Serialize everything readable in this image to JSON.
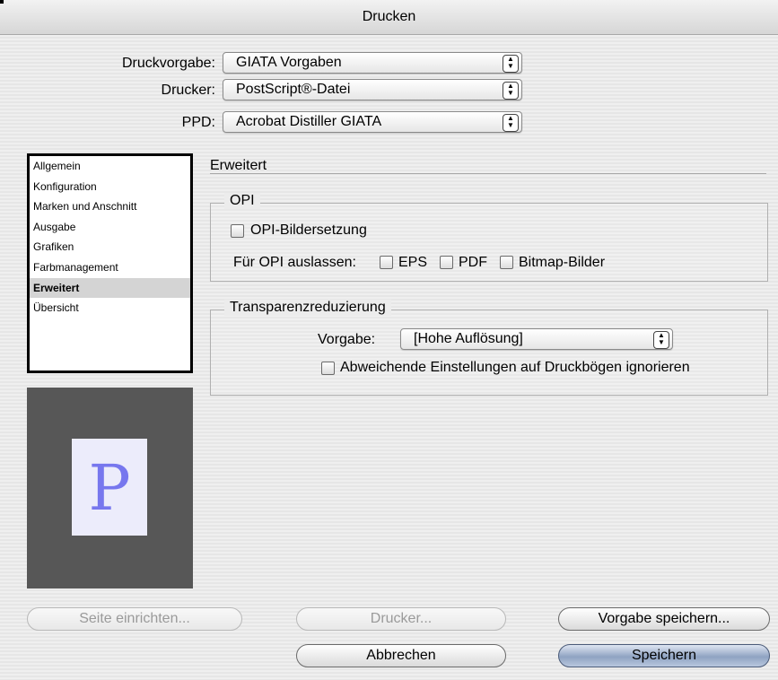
{
  "window": {
    "title": "Drucken"
  },
  "fields": {
    "preset_label": "Druckvorgabe:",
    "preset_value": "GIATA Vorgaben",
    "printer_label": "Drucker:",
    "printer_value": "PostScript®-Datei",
    "ppd_label": "PPD:",
    "ppd_value": "Acrobat Distiller GIATA"
  },
  "sidebar": {
    "items": [
      {
        "label": "Allgemein"
      },
      {
        "label": "Konfiguration"
      },
      {
        "label": "Marken und Anschnitt"
      },
      {
        "label": "Ausgabe"
      },
      {
        "label": "Grafiken"
      },
      {
        "label": "Farbmanagement"
      },
      {
        "label": "Erweitert",
        "selected": true
      },
      {
        "label": "Übersicht"
      }
    ]
  },
  "preview": {
    "letter": "P",
    "accent": "#7777ee"
  },
  "section": {
    "title": "Erweitert"
  },
  "opi": {
    "title": "OPI",
    "replace_label": "OPI-Bildersetzung",
    "omit_label": "Für OPI auslassen:",
    "eps_label": "EPS",
    "pdf_label": "PDF",
    "bitmap_label": "Bitmap-Bilder"
  },
  "transparency": {
    "title": "Transparenzreduzierung",
    "preset_label": "Vorgabe:",
    "preset_value": "[Hohe Auflösung]",
    "ignore_label": "Abweichende Einstellungen auf Druckbögen ignorieren"
  },
  "buttons": {
    "page_setup": "Seite einrichten...",
    "printer": "Drucker...",
    "save_preset": "Vorgabe speichern...",
    "cancel": "Abbrechen",
    "save": "Speichern"
  }
}
